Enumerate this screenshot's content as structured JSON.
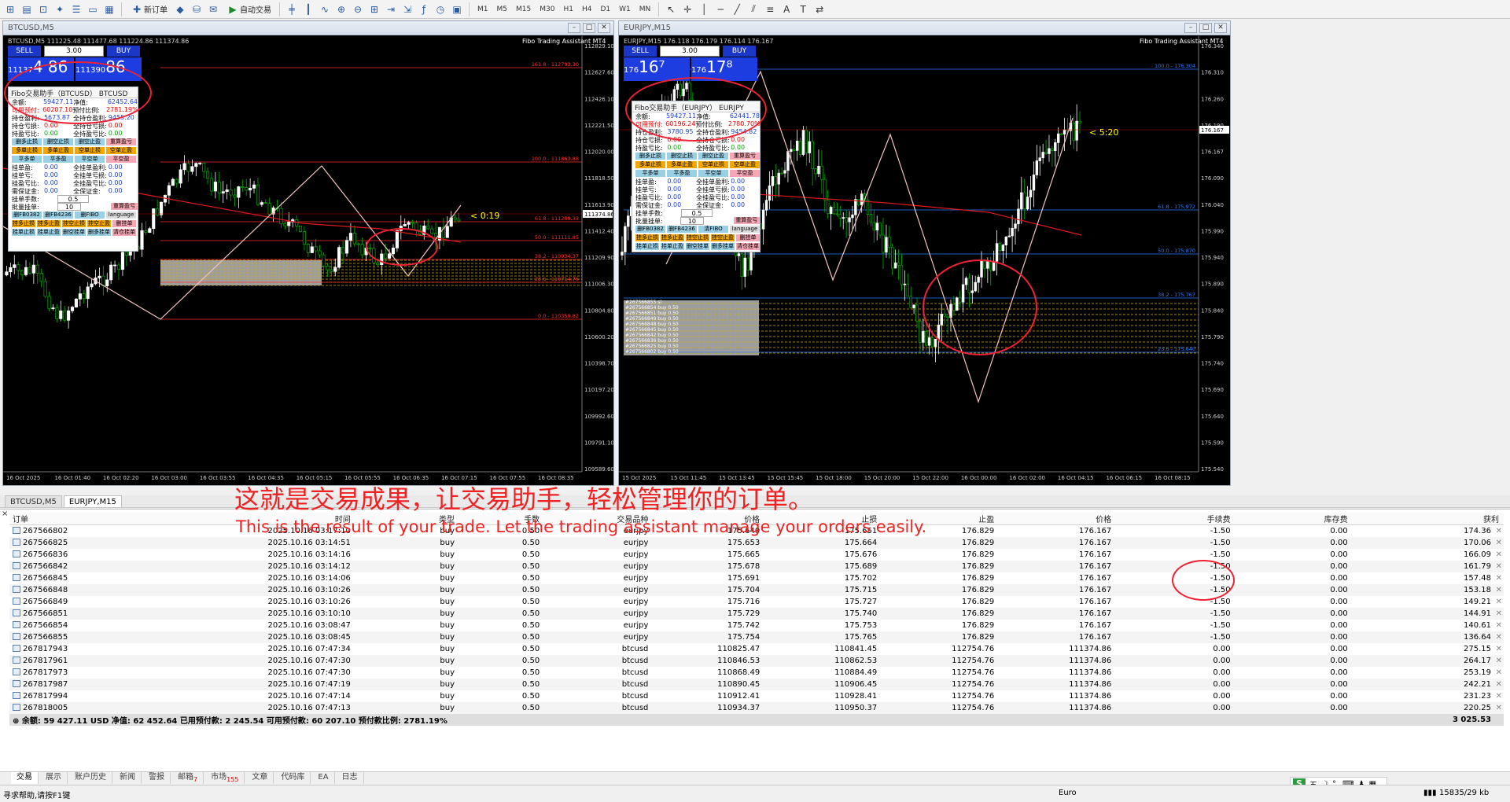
{
  "toolbar": {
    "new_order": "新订单",
    "auto_trading": "自动交易",
    "timeframes": [
      "M1",
      "M5",
      "M15",
      "M30",
      "H1",
      "H4",
      "D1",
      "W1",
      "MN"
    ]
  },
  "windows": [
    {
      "id": "left",
      "title": "BTCUSD,M5",
      "info_line": "BTCUSD,M5 111225.48 111477.68 111224.86 111374.86",
      "brand": "Fibo Trading Assistant MT4",
      "sell_label": "SELL",
      "buy_label": "BUY",
      "lot": "3.00",
      "sell_price_small": "11137",
      "sell_price_big": "4 86",
      "buy_price_small": "111390",
      "buy_price_big": "86",
      "countdown": "< 0:19",
      "y_ticks": [
        "112829.10",
        "112627.60",
        "112426.10",
        "112221.50",
        "112020.00",
        "111818.50",
        "111613.90",
        "111412.40",
        "111209.90",
        "111006.30",
        "110804.80",
        "110600.20",
        "110398.70",
        "110197.20",
        "109992.60",
        "109791.10",
        "109589.60"
      ],
      "current_price_label": "111374.86",
      "x_ticks": [
        "16 Oct 2025",
        "16 Oct 01:40",
        "16 Oct 02:20",
        "16 Oct 03:00",
        "16 Oct 03:55",
        "16 Oct 04:35",
        "16 Oct 05:15",
        "16 Oct 05:55",
        "16 Oct 06:35",
        "16 Oct 07:15",
        "16 Oct 07:55",
        "16 Oct 08:35"
      ],
      "fibo": [
        "161.8 - 112793.30",
        "100.0 - 111863.88",
        "61.8 - 111289.33",
        "50.0 - 111111.85",
        "38.2 - 110934.37",
        "23.6 - 110714.76",
        "0.0 - 110359.82"
      ],
      "panel": {
        "title": "Fibo交易助手（BTCUSD） BTCUSD",
        "balance_k": "余额:",
        "balance_v": "59427.11",
        "equity_k": "净值:",
        "equity_v": "62452.64",
        "free_k": "可用预付:",
        "free_v": "60207.10",
        "ratio_k": "预付比例:",
        "ratio_v": "2781.19%",
        "pos_pl_k": "持仓盈利:",
        "pos_pl_v": "5673.87",
        "all_pl_k": "全持仓盈利:",
        "all_pl_v": "9455.20",
        "pos_loss_k": "持仓亏损:",
        "pos_loss_v": "0.00",
        "all_loss_k": "全持仓亏损:",
        "all_loss_v": "0.00",
        "pos_rate_k": "持盈亏比:",
        "pos_rate_v": "0.00",
        "all_rate_k": "全持盈亏比:",
        "all_rate_v": "0.00",
        "buttons1": [
          "删多止损",
          "删空止损",
          "删空止盈",
          "重算盈亏",
          "多单止损",
          "多单止盈",
          "空单止损",
          "空单止盈",
          "平多单",
          "平多盈",
          "平空单",
          "平空盈"
        ],
        "pend_pl_k": "挂单盈:",
        "pend_pl_v": "0.00",
        "all_pend_pl_k": "全挂单盈利:",
        "all_pend_pl_v": "0.00",
        "pend_loss_k": "挂单亏:",
        "pend_loss_v": "0.00",
        "all_pend_loss_k": "全挂单亏损:",
        "all_pend_loss_v": "0.00",
        "pend_rate_k": "挂盈亏比:",
        "pend_rate_v": "0.00",
        "all_pend_rate_k": "全挂盈亏比:",
        "all_pend_rate_v": "0.00",
        "margin_k": "需保证金:",
        "margin_v": "0.00",
        "all_margin_k": "全保证金:",
        "all_margin_v": "0.00",
        "lot_label": "挂单手数:",
        "lot_value": "0.5",
        "batch_label": "批量挂单:",
        "batch_value": "10",
        "recalc": "重算盈亏",
        "fib_buttons": [
          "删FB0382",
          "删FB4236",
          "删FIBO",
          "language"
        ],
        "buttons2": [
          "挂多止损",
          "挂多止盈",
          "挂空止损",
          "挂空止盈",
          "删挂单",
          "挂单止损",
          "挂单止盈",
          "删空挂单",
          "删多挂单",
          "清仓挂单"
        ]
      }
    },
    {
      "id": "right",
      "title": "EURJPY,M15",
      "info_line": "EURJPY,M15 176.118 176.179 176.114 176.167",
      "brand": "Fibo Trading Assistant MT4",
      "sell_label": "SELL",
      "buy_label": "BUY",
      "lot": "3.00",
      "sell_price_small": "176",
      "sell_price_big": "16⁷",
      "buy_price_small": "176",
      "buy_price_big": "17⁸",
      "countdown": "< 5:20",
      "y_ticks": [
        "176.340",
        "176.310",
        "176.260",
        "176.190",
        "176.167",
        "176.090",
        "176.040",
        "175.990",
        "175.940",
        "175.890",
        "175.840",
        "175.790",
        "175.740",
        "175.690",
        "175.640",
        "175.590",
        "175.540"
      ],
      "current_price_label": "176.167",
      "x_ticks": [
        "15 Oct 2025",
        "15 Oct 11:45",
        "15 Oct 13:45",
        "15 Oct 15:45",
        "15 Oct 18:00",
        "15 Oct 20:00",
        "15 Oct 22:00",
        "16 Oct 00:00",
        "16 Oct 02:00",
        "16 Oct 04:15",
        "16 Oct 06:15",
        "16 Oct 08:15"
      ],
      "fibo": [
        "100.0 - 176.304",
        "61.8 - 175.972",
        "50.0 - 175.870",
        "38.2 - 175.767",
        "23.6 - 175.640"
      ],
      "orders_overlay": [
        "#267566855 sl",
        "#267566854 buy 0.50",
        "#267566851 buy 0.50",
        "#267566849 buy 0.50",
        "#267566848 buy 0.50",
        "#267566845 buy 0.50",
        "#267566842 buy 0.50",
        "#267566836 buy 0.50",
        "#267566825 buy 0.50",
        "#267566802 buy 0.50"
      ],
      "panel": {
        "title": "Fibo交易助手（EURJPY） EURJPY",
        "balance_k": "余额:",
        "balance_v": "59427.11",
        "equity_k": "净值:",
        "equity_v": "62441.78",
        "free_k": "可用预付:",
        "free_v": "60196.24",
        "ratio_k": "预付比例:",
        "ratio_v": "2780.70%",
        "pos_pl_k": "持仓盈利:",
        "pos_pl_v": "3780.95",
        "all_pl_k": "全持仓盈利:",
        "all_pl_v": "9454.82",
        "pos_loss_k": "持仓亏损:",
        "pos_loss_v": "0.00",
        "all_loss_k": "全持仓亏损:",
        "all_loss_v": "0.00",
        "pos_rate_k": "持盈亏比:",
        "pos_rate_v": "0.00",
        "all_rate_k": "全持盈亏比:",
        "all_rate_v": "0.00",
        "buttons1": [
          "删多止损",
          "删空止损",
          "删空止盈",
          "重算盈亏",
          "多单止损",
          "多单止盈",
          "空单止损",
          "空单止盈",
          "平多单",
          "平多盈",
          "平空单",
          "平空盈"
        ],
        "pend_pl_k": "挂单盈:",
        "pend_pl_v": "0.00",
        "all_pend_pl_k": "全挂单盈利:",
        "all_pend_pl_v": "0.00",
        "pend_loss_k": "挂单亏:",
        "pend_loss_v": "0.00",
        "all_pend_loss_k": "全挂单亏损:",
        "all_pend_loss_v": "0.00",
        "pend_rate_k": "挂盈亏比:",
        "pend_rate_v": "0.00",
        "all_pend_rate_k": "全挂盈亏比:",
        "all_pend_rate_v": "0.00",
        "margin_k": "需保证金:",
        "margin_v": "0.00",
        "all_margin_k": "全保证金:",
        "all_margin_v": "0.00",
        "lot_label": "挂单手数:",
        "lot_value": "0.5",
        "batch_label": "批量挂单:",
        "batch_value": "10",
        "recalc": "重算盈亏",
        "fib_buttons": [
          "删FB0382",
          "删FB4236",
          "清FIBO",
          "language"
        ],
        "buttons2": [
          "挂多止损",
          "挂多止盈",
          "挂空止损",
          "挂空止盈",
          "删挂单",
          "挂单止损",
          "挂单止盈",
          "删空挂单",
          "删多挂单",
          "清仓挂单"
        ]
      }
    }
  ],
  "chart_tabs": [
    "BTCUSD,M5",
    "EURJPY,M15"
  ],
  "terminal": {
    "columns": [
      "订单",
      "时间",
      "类型",
      "手数",
      "交易品种",
      "价格",
      "止损",
      "止盈",
      "价格",
      "手续费",
      "库存费",
      "获利"
    ],
    "rows": [
      [
        "267566802",
        "2025.10.16 03:17:10",
        "buy",
        "0.50",
        "eurjpy",
        "175.640",
        "175.651",
        "176.829",
        "176.167",
        "-1.50",
        "0.00",
        "174.36"
      ],
      [
        "267566825",
        "2025.10.16 03:14:51",
        "buy",
        "0.50",
        "eurjpy",
        "175.653",
        "175.664",
        "176.829",
        "176.167",
        "-1.50",
        "0.00",
        "170.06"
      ],
      [
        "267566836",
        "2025.10.16 03:14:16",
        "buy",
        "0.50",
        "eurjpy",
        "175.665",
        "175.676",
        "176.829",
        "176.167",
        "-1.50",
        "0.00",
        "166.09"
      ],
      [
        "267566842",
        "2025.10.16 03:14:12",
        "buy",
        "0.50",
        "eurjpy",
        "175.678",
        "175.689",
        "176.829",
        "176.167",
        "-1.50",
        "0.00",
        "161.79"
      ],
      [
        "267566845",
        "2025.10.16 03:14:06",
        "buy",
        "0.50",
        "eurjpy",
        "175.691",
        "175.702",
        "176.829",
        "176.167",
        "-1.50",
        "0.00",
        "157.48"
      ],
      [
        "267566848",
        "2025.10.16 03:10:26",
        "buy",
        "0.50",
        "eurjpy",
        "175.704",
        "175.715",
        "176.829",
        "176.167",
        "-1.50",
        "0.00",
        "153.18"
      ],
      [
        "267566849",
        "2025.10.16 03:10:26",
        "buy",
        "0.50",
        "eurjpy",
        "175.716",
        "175.727",
        "176.829",
        "176.167",
        "-1.50",
        "0.00",
        "149.21"
      ],
      [
        "267566851",
        "2025.10.16 03:10:10",
        "buy",
        "0.50",
        "eurjpy",
        "175.729",
        "175.740",
        "176.829",
        "176.167",
        "-1.50",
        "0.00",
        "144.91"
      ],
      [
        "267566854",
        "2025.10.16 03:08:47",
        "buy",
        "0.50",
        "eurjpy",
        "175.742",
        "175.753",
        "176.829",
        "176.167",
        "-1.50",
        "0.00",
        "140.61"
      ],
      [
        "267566855",
        "2025.10.16 03:08:45",
        "buy",
        "0.50",
        "eurjpy",
        "175.754",
        "175.765",
        "176.829",
        "176.167",
        "-1.50",
        "0.00",
        "136.64"
      ],
      [
        "267817943",
        "2025.10.16 07:47:34",
        "buy",
        "0.50",
        "btcusd",
        "110825.47",
        "110841.45",
        "112754.76",
        "111374.86",
        "0.00",
        "0.00",
        "275.15"
      ],
      [
        "267817961",
        "2025.10.16 07:47:30",
        "buy",
        "0.50",
        "btcusd",
        "110846.53",
        "110862.53",
        "112754.76",
        "111374.86",
        "0.00",
        "0.00",
        "264.17"
      ],
      [
        "267817973",
        "2025.10.16 07:47:30",
        "buy",
        "0.50",
        "btcusd",
        "110868.49",
        "110884.49",
        "112754.76",
        "111374.86",
        "0.00",
        "0.00",
        "253.19"
      ],
      [
        "267817987",
        "2025.10.16 07:47:19",
        "buy",
        "0.50",
        "btcusd",
        "110890.45",
        "110906.45",
        "112754.76",
        "111374.86",
        "0.00",
        "0.00",
        "242.21"
      ],
      [
        "267817994",
        "2025.10.16 07:47:14",
        "buy",
        "0.50",
        "btcusd",
        "110912.41",
        "110928.41",
        "112754.76",
        "111374.86",
        "0.00",
        "0.00",
        "231.23"
      ],
      [
        "267818005",
        "2025.10.16 07:47:13",
        "buy",
        "0.50",
        "btcusd",
        "110934.37",
        "110950.37",
        "112754.76",
        "111374.86",
        "0.00",
        "0.00",
        "220.25"
      ]
    ],
    "summary": "余额: 59 427.11 USD  净值: 62 452.64  已用预付款: 2 245.54  可用预付款: 60 207.10  预付款比例: 2781.19%",
    "summary_total": "3 025.53"
  },
  "overlay": {
    "zh": "这就是交易成果，让交易助手，轻松管理你的订单。",
    "en": "This is the result of your trade. Let the trading assistant manage your orders easily."
  },
  "bottom_tabs": [
    "交易",
    "展示",
    "账户历史",
    "新闻",
    "警报",
    "邮箱",
    "市场",
    "文章",
    "代码库",
    "EA",
    "日志"
  ],
  "bottom_badges": {
    "mail": "7",
    "market": "155"
  },
  "status": {
    "help": "寻求帮助,请按F1键",
    "profile": "Euro",
    "traffic": "15835/29 kb"
  },
  "colors": {
    "buy_button": "#1a37c8",
    "price_box": "#1e3de0",
    "profit_ring": "#e23",
    "bull_candle": "#ffffff",
    "bear_candle": "#00a000",
    "ma_line": "#e01a1a",
    "fibo_line": "#ff3030"
  }
}
